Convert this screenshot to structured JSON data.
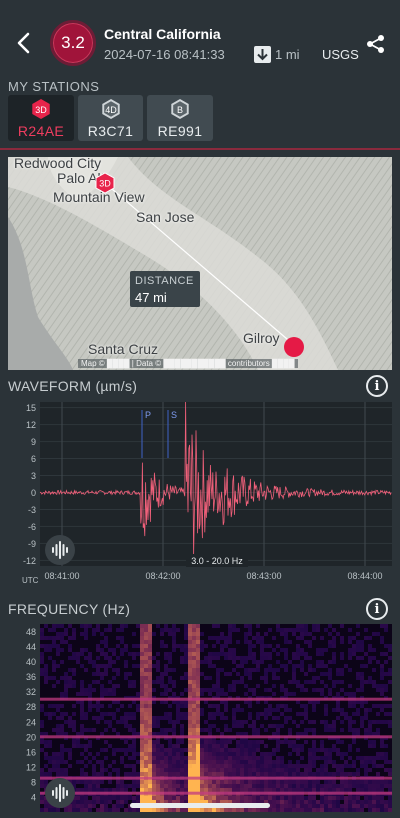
{
  "header": {
    "back_icon": "chevron-left-icon",
    "magnitude": "3.2",
    "region": "Central California",
    "datetime": "2024-07-16 08:41:33",
    "depth_icon": "depth-arrow-icon",
    "depth": "1 mi",
    "source": "USGS",
    "share_icon": "share-icon",
    "colors": {
      "magnitude_badge": "#a0143a",
      "accent": "#ee3d5f",
      "background": "#2b3338"
    }
  },
  "stations": {
    "label": "MY STATIONS",
    "items": [
      {
        "badge": "3D",
        "name": "R24AE",
        "selected": true,
        "badge_color": "#e8244b"
      },
      {
        "badge": "4D",
        "name": "R3C71",
        "selected": false,
        "badge_color": "#cfd5d8"
      },
      {
        "badge": "B",
        "name": "RE991",
        "selected": false,
        "badge_color": "#cfd5d8"
      }
    ]
  },
  "map": {
    "places": [
      "Redwood City",
      "Palo Alto",
      "Mountain View",
      "San Jose",
      "Santa Cruz",
      "Gilroy"
    ],
    "station_marker": "3D",
    "distance_label": "DISTANCE",
    "distance_value": "47 mi",
    "attribution": "Map © ████ | Data © ███████████ contributors ████"
  },
  "waveform": {
    "title": "WAVEFORM (µm/s)",
    "info_icon": "info-icon",
    "audio_icon": "audio-wave-icon",
    "y_ticks": [
      "15",
      "12",
      "9",
      "6",
      "3",
      "0",
      "-3",
      "-6",
      "-9",
      "-12"
    ],
    "x_ticks": [
      "08:41:00",
      "08:42:00",
      "08:43:00",
      "08:44:00"
    ],
    "x_unit": "UTC",
    "phases": [
      "P",
      "S"
    ],
    "filter": "3.0 - 20.0 Hz",
    "trace_color": "#f0607a"
  },
  "frequency": {
    "title": "FREQUENCY (Hz)",
    "info_icon": "info-icon",
    "audio_icon": "audio-wave-icon",
    "y_ticks": [
      "48",
      "44",
      "40",
      "36",
      "32",
      "28",
      "24",
      "20",
      "16",
      "12",
      "8",
      "4"
    ]
  },
  "chart_data": [
    {
      "type": "line",
      "title": "WAVEFORM (µm/s)",
      "xlabel": "UTC",
      "ylabel": "",
      "x": [
        "08:41:00",
        "08:42:00",
        "08:43:00",
        "08:44:00"
      ],
      "ylim": [
        -13,
        16
      ],
      "series": [],
      "annotations": [
        "P",
        "S",
        "3.0 - 20.0 Hz"
      ]
    },
    {
      "type": "heatmap",
      "title": "FREQUENCY (Hz)",
      "ylabel": "",
      "yticks": [
        48,
        44,
        40,
        36,
        32,
        28,
        24,
        20,
        16,
        12,
        8,
        4
      ],
      "ylim": [
        0,
        50
      ]
    }
  ]
}
